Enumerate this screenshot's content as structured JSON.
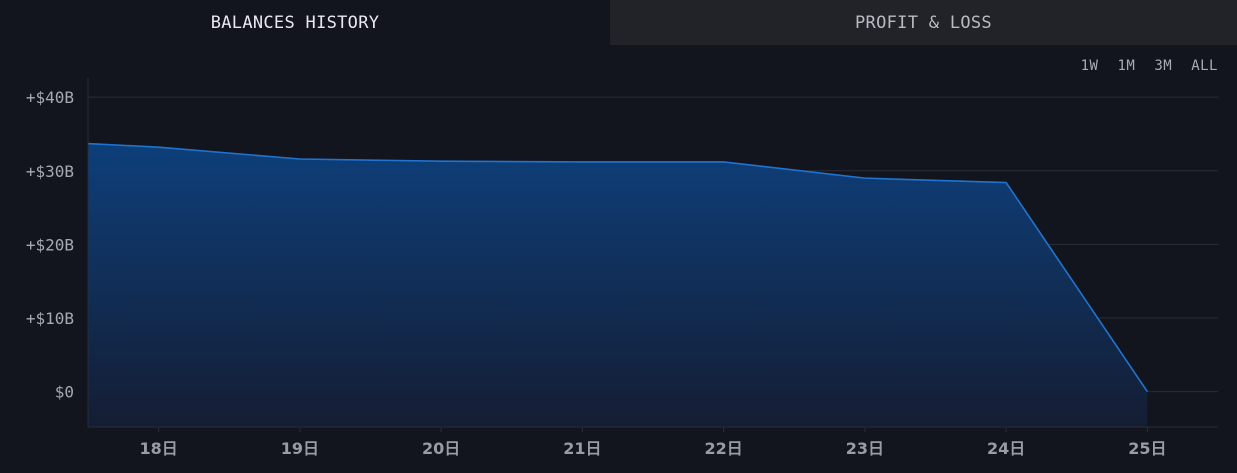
{
  "tabs": [
    {
      "label": "BALANCES HISTORY",
      "active": true
    },
    {
      "label": "PROFIT & LOSS",
      "active": false
    }
  ],
  "ranges": [
    {
      "label": "1W"
    },
    {
      "label": "1M"
    },
    {
      "label": "3M"
    },
    {
      "label": "ALL"
    }
  ],
  "colors": {
    "background": "#13151e",
    "line": "#1f74d1",
    "fill_top": "#0e3f7a",
    "fill_bottom": "#141d33",
    "grid": "#2a2d38",
    "inactive_tab": "#212329"
  },
  "chart_data": {
    "type": "area",
    "x_labels": [
      "18日",
      "19日",
      "20日",
      "21日",
      "22日",
      "23日",
      "24日",
      "25日"
    ],
    "y_ticks": [
      {
        "value": 0,
        "label": "$0"
      },
      {
        "value": 10,
        "label": "+$10B"
      },
      {
        "value": 20,
        "label": "+$20B"
      },
      {
        "value": 30,
        "label": "+$30B"
      },
      {
        "value": 40,
        "label": "+$40B"
      }
    ],
    "xlim": [
      17.5,
      25.5
    ],
    "ylim": [
      -4.8,
      42.6
    ],
    "y_unit": "B USD",
    "grid": true,
    "series": [
      {
        "points": [
          {
            "x": 17.5,
            "y": 33.7
          },
          {
            "x": 18.0,
            "y": 33.2
          },
          {
            "x": 19.0,
            "y": 31.6
          },
          {
            "x": 20.0,
            "y": 31.3
          },
          {
            "x": 21.0,
            "y": 31.2
          },
          {
            "x": 22.0,
            "y": 31.2
          },
          {
            "x": 23.0,
            "y": 29.0
          },
          {
            "x": 24.0,
            "y": 28.4
          },
          {
            "x": 25.0,
            "y": 0.0
          }
        ]
      }
    ]
  }
}
